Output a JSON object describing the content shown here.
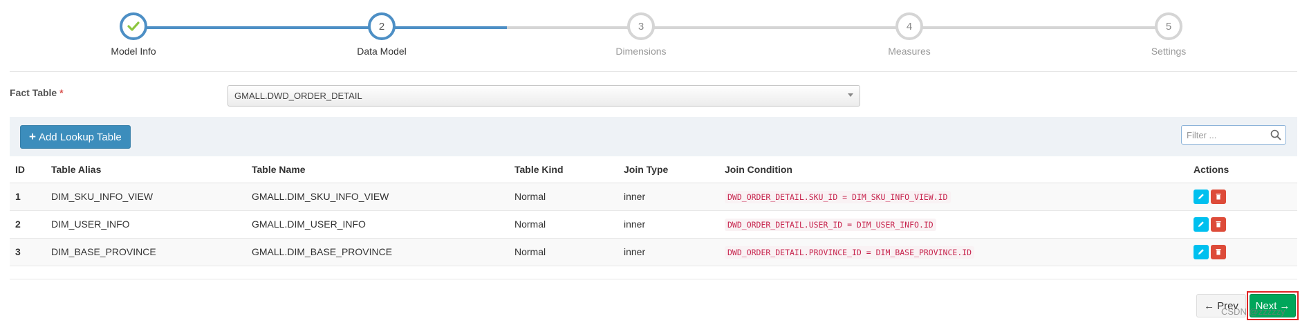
{
  "wizard": {
    "steps": [
      {
        "number": "1",
        "label": "Model Info",
        "state": "done"
      },
      {
        "number": "2",
        "label": "Data Model",
        "state": "active"
      },
      {
        "number": "3",
        "label": "Dimensions",
        "state": "pending"
      },
      {
        "number": "4",
        "label": "Measures",
        "state": "pending"
      },
      {
        "number": "5",
        "label": "Settings",
        "state": "pending"
      }
    ]
  },
  "fact_table": {
    "label": "Fact Table",
    "required_mark": "*",
    "selected": "GMALL.DWD_ORDER_DETAIL"
  },
  "toolbar": {
    "add_label": "Add Lookup Table",
    "filter_placeholder": "Filter ..."
  },
  "table": {
    "headers": {
      "id": "ID",
      "alias": "Table Alias",
      "name": "Table Name",
      "kind": "Table Kind",
      "join_type": "Join Type",
      "condition": "Join Condition",
      "actions": "Actions"
    },
    "rows": [
      {
        "id": "1",
        "alias": "DIM_SKU_INFO_VIEW",
        "name": "GMALL.DIM_SKU_INFO_VIEW",
        "kind": "Normal",
        "join_type": "inner",
        "condition": "DWD_ORDER_DETAIL.SKU_ID = DIM_SKU_INFO_VIEW.ID"
      },
      {
        "id": "2",
        "alias": "DIM_USER_INFO",
        "name": "GMALL.DIM_USER_INFO",
        "kind": "Normal",
        "join_type": "inner",
        "condition": "DWD_ORDER_DETAIL.USER_ID = DIM_USER_INFO.ID"
      },
      {
        "id": "3",
        "alias": "DIM_BASE_PROVINCE",
        "name": "GMALL.DIM_BASE_PROVINCE",
        "kind": "Normal",
        "join_type": "inner",
        "condition": "DWD_ORDER_DETAIL.PROVINCE_ID = DIM_BASE_PROVINCE.ID"
      }
    ]
  },
  "footer": {
    "prev_label": "Prev",
    "next_label": "Next",
    "watermark": "CSDN @zzzzzy"
  },
  "colors": {
    "wizard_active": "#4d8fc5",
    "check": "#8dc63f",
    "add_button": "#3c8dbc",
    "next_button": "#00a65a",
    "edit_button": "#00c0ef",
    "delete_button": "#dd4b39",
    "highlight_outline": "#e02424"
  }
}
